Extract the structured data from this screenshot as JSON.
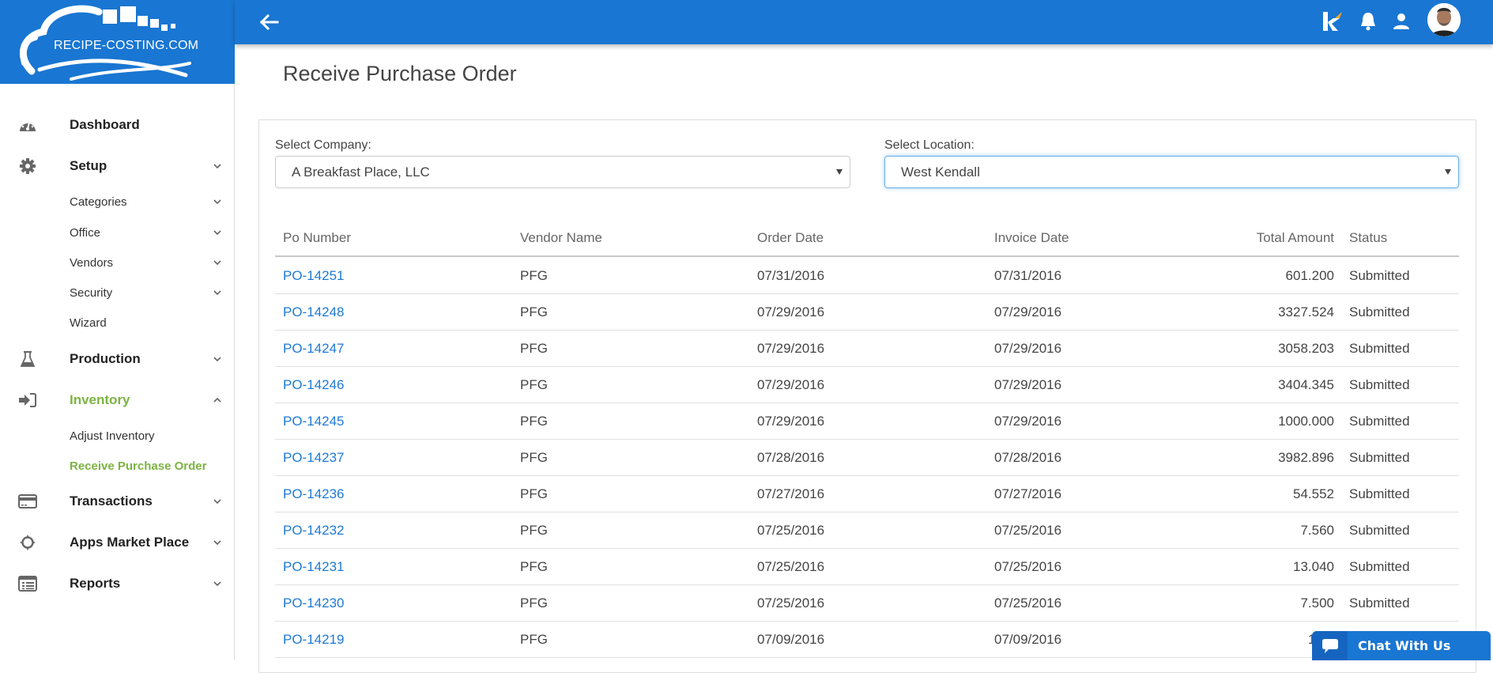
{
  "brand": {
    "logo_text": "RECIPE-COSTING.COM",
    "accent_color": "#1976d2",
    "active_color": "#7cb342"
  },
  "sidebar": {
    "items": [
      {
        "label": "Dashboard",
        "icon": "dashboard-gauge-icon"
      },
      {
        "label": "Setup",
        "icon": "gear-icon",
        "expandable": true
      },
      {
        "label": "Categories",
        "sub": true,
        "expandable": true
      },
      {
        "label": "Office",
        "sub": true,
        "expandable": true
      },
      {
        "label": "Vendors",
        "sub": true,
        "expandable": true
      },
      {
        "label": "Security",
        "sub": true,
        "expandable": true
      },
      {
        "label": "Wizard",
        "sub": true
      },
      {
        "label": "Production",
        "icon": "flask-icon",
        "expandable": true
      },
      {
        "label": "Inventory",
        "icon": "sign-in-icon",
        "expandable": true,
        "expanded": true,
        "active": true
      },
      {
        "label": "Adjust Inventory",
        "sub": true
      },
      {
        "label": "Receive Purchase Order",
        "sub": true,
        "active": true
      },
      {
        "label": "Transactions",
        "icon": "credit-card-icon",
        "expandable": true
      },
      {
        "label": "Apps Market Place",
        "icon": "crosshairs-icon",
        "expandable": true
      },
      {
        "label": "Reports",
        "icon": "list-alt-icon",
        "expandable": true
      }
    ]
  },
  "topbar": {
    "icons": [
      "back-arrow-icon",
      "k-logo-icon",
      "bell-icon",
      "user-icon",
      "avatar"
    ]
  },
  "page": {
    "title": "Receive Purchase Order"
  },
  "filters": {
    "company_label": "Select Company:",
    "company_value": "A Breakfast Place, LLC",
    "location_label": "Select Location:",
    "location_value": "West Kendall"
  },
  "table": {
    "columns": [
      "Po Number",
      "Vendor Name",
      "Order Date",
      "Invoice Date",
      "Total Amount",
      "Status"
    ],
    "rows": [
      {
        "po": "PO-14251",
        "vendor": "PFG",
        "order_date": "07/31/2016",
        "invoice_date": "07/31/2016",
        "total": "601.200",
        "status": "Submitted"
      },
      {
        "po": "PO-14248",
        "vendor": "PFG",
        "order_date": "07/29/2016",
        "invoice_date": "07/29/2016",
        "total": "3327.524",
        "status": "Submitted"
      },
      {
        "po": "PO-14247",
        "vendor": "PFG",
        "order_date": "07/29/2016",
        "invoice_date": "07/29/2016",
        "total": "3058.203",
        "status": "Submitted"
      },
      {
        "po": "PO-14246",
        "vendor": "PFG",
        "order_date": "07/29/2016",
        "invoice_date": "07/29/2016",
        "total": "3404.345",
        "status": "Submitted"
      },
      {
        "po": "PO-14245",
        "vendor": "PFG",
        "order_date": "07/29/2016",
        "invoice_date": "07/29/2016",
        "total": "1000.000",
        "status": "Submitted"
      },
      {
        "po": "PO-14237",
        "vendor": "PFG",
        "order_date": "07/28/2016",
        "invoice_date": "07/28/2016",
        "total": "3982.896",
        "status": "Submitted"
      },
      {
        "po": "PO-14236",
        "vendor": "PFG",
        "order_date": "07/27/2016",
        "invoice_date": "07/27/2016",
        "total": "54.552",
        "status": "Submitted"
      },
      {
        "po": "PO-14232",
        "vendor": "PFG",
        "order_date": "07/25/2016",
        "invoice_date": "07/25/2016",
        "total": "7.560",
        "status": "Submitted"
      },
      {
        "po": "PO-14231",
        "vendor": "PFG",
        "order_date": "07/25/2016",
        "invoice_date": "07/25/2016",
        "total": "13.040",
        "status": "Submitted"
      },
      {
        "po": "PO-14230",
        "vendor": "PFG",
        "order_date": "07/25/2016",
        "invoice_date": "07/25/2016",
        "total": "7.500",
        "status": "Submitted"
      },
      {
        "po": "PO-14219",
        "vendor": "PFG",
        "order_date": "07/09/2016",
        "invoice_date": "07/09/2016",
        "total": "168.",
        "status": ""
      }
    ]
  },
  "chat": {
    "label": "Chat With Us"
  }
}
